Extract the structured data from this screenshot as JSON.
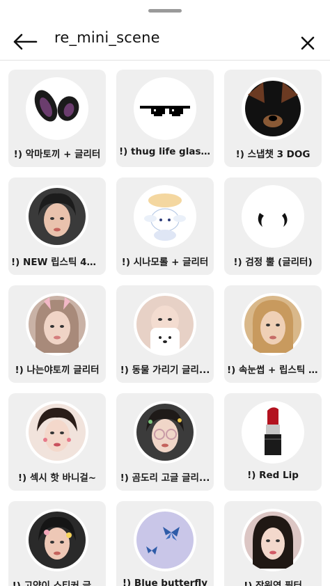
{
  "header": {
    "query": "re_mini_scene"
  },
  "effects": [
    {
      "label": "!) 악마토끼 + 글리터",
      "icon": "bunny-ears-icon"
    },
    {
      "label": "!) thug life glasses",
      "icon": "pixel-glasses-icon"
    },
    {
      "label": "!) 스냅챗 3 DOG",
      "icon": "dog-filter-icon"
    },
    {
      "label": "!) NEW 립스틱 4가...",
      "icon": "face-preview"
    },
    {
      "label": "!) 시나모롤 + 글리터",
      "icon": "cinnamoroll-icon"
    },
    {
      "label": "!) 검정 뿔 (글리터)",
      "icon": "black-horns-icon"
    },
    {
      "label": "!) 나는야토끼 글리터",
      "icon": "face-preview"
    },
    {
      "label": "!) 동물 가리기 글리...",
      "icon": "face-preview"
    },
    {
      "label": "!) 속눈썹 + 립스틱 ...",
      "icon": "face-preview"
    },
    {
      "label": "!) 섹시 핫 바니걸~",
      "icon": "face-preview"
    },
    {
      "label": "!) 곰도리 고글 글리...",
      "icon": "face-preview"
    },
    {
      "label": "!) Red Lip",
      "icon": "lipstick-icon"
    },
    {
      "label": "!) 고양이 스티커 글...",
      "icon": "face-preview"
    },
    {
      "label": "!) Blue butterfly",
      "icon": "butterfly-icon"
    },
    {
      "label": "!) 장원영 필터",
      "icon": "face-preview"
    }
  ]
}
